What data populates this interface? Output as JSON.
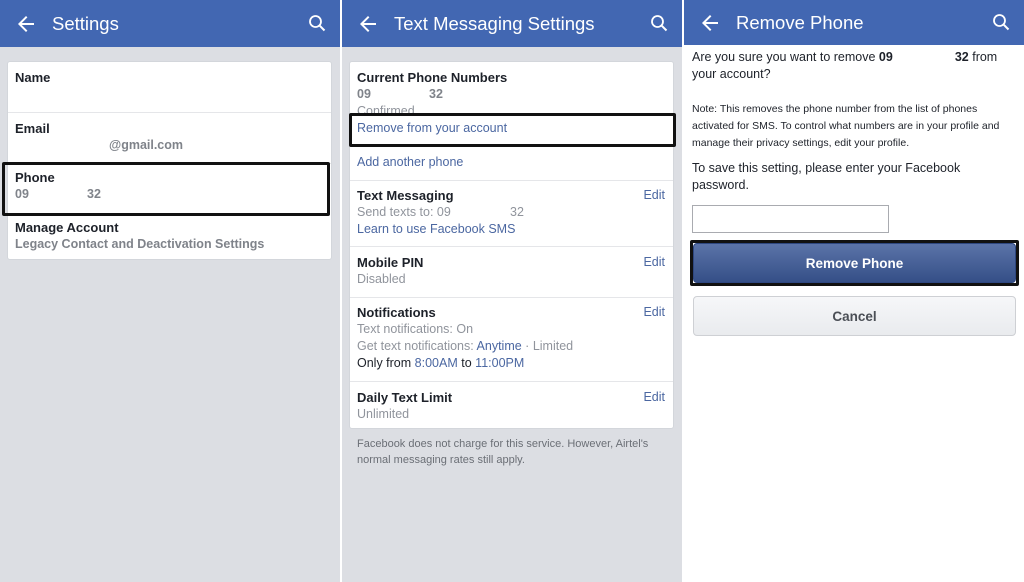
{
  "settings": {
    "title": "Settings",
    "items": [
      {
        "label": "Name",
        "value": ""
      },
      {
        "label": "Email",
        "value": "@gmail.com"
      },
      {
        "label": "Phone",
        "value_start": "09",
        "value_end": "32"
      },
      {
        "label": "Manage Account",
        "value": "Legacy Contact and Deactivation Settings"
      }
    ]
  },
  "text_messaging": {
    "title": "Text Messaging Settings",
    "current_phone": {
      "label": "Current Phone Numbers",
      "number_start": "09",
      "number_end": "32",
      "status": "Confirmed",
      "remove_link": "Remove from your account",
      "add_link": "Add another phone"
    },
    "sms": {
      "label": "Text Messaging",
      "edit": "Edit",
      "send_prefix": "Send texts to: 09",
      "send_end": "32",
      "learn_link": "Learn to use Facebook SMS"
    },
    "pin": {
      "label": "Mobile PIN",
      "edit": "Edit",
      "value": "Disabled"
    },
    "notifications": {
      "label": "Notifications",
      "edit": "Edit",
      "line1": "Text notifications: On",
      "line2_prefix": "Get text notifications:",
      "line2_link": "Anytime",
      "line2_sep": "·",
      "line2_suffix": "Limited",
      "line3_prefix": "Only from",
      "line3_from": "8:00AM",
      "line3_mid": "to",
      "line3_to": "11:00PM"
    },
    "daily_limit": {
      "label": "Daily Text Limit",
      "edit": "Edit",
      "value": "Unlimited"
    },
    "footer": "Facebook does not charge for this service. However, Airtel's normal messaging rates still apply."
  },
  "remove_phone": {
    "title": "Remove Phone",
    "question_prefix": "Are you sure you want to remove",
    "number_start": "09",
    "number_end": "32",
    "question_suffix": "from your account?",
    "note": "Note: This removes the phone number from the list of phones activated for SMS. To control what numbers are in your profile and manage their privacy settings, edit your profile.",
    "save_prompt": "To save this setting, please enter your Facebook password.",
    "password_placeholder": "",
    "remove_button": "Remove Phone",
    "cancel_button": "Cancel"
  },
  "colors": {
    "header": "#4267b2",
    "link": "#4b67a1",
    "primary_button": "#3b5998"
  }
}
